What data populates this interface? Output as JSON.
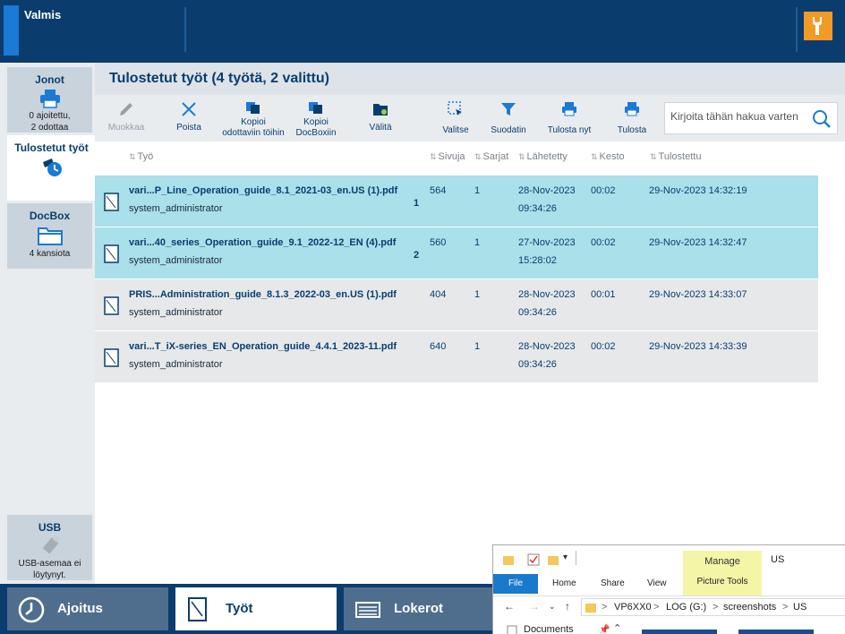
{
  "status": {
    "text": "Valmis"
  },
  "leftnav": {
    "queues": {
      "title": "Jonot",
      "line1": "0 ajoitettu,",
      "line2": "2 odottaa"
    },
    "printed": {
      "title": "Tulostetut työt"
    },
    "docbox": {
      "title": "DocBox",
      "sub": "4 kansiota"
    },
    "usb": {
      "title": "USB",
      "line1": "USB-asemaa ei",
      "line2": "löytynyt."
    }
  },
  "main": {
    "title": "Tulostetut työt (4 työtä, 2 valittu)",
    "toolbar": {
      "edit": "Muokkaa",
      "delete": "Poista",
      "copy_waiting_1": "Kopioi",
      "copy_waiting_2": "odottaviin töihin",
      "copy_docbox_1": "Kopioi",
      "copy_docbox_2": "DocBoxiin",
      "forward": "Välitä",
      "select": "Valitse",
      "filter": "Suodatin",
      "print_now": "Tulosta nyt",
      "print": "Tulosta"
    },
    "search": {
      "placeholder": "Kirjoita tähän hakua varten"
    },
    "columns": {
      "job": "Työ",
      "pages": "Sivuja",
      "sets": "Sarjat",
      "sent": "Lähetetty",
      "duration": "Kesto",
      "printed": "Tulostettu"
    },
    "rows": [
      {
        "name": "vari...P_Line_Operation_guide_8.1_2021-03_en.US (1).pdf",
        "owner": "system_administrator",
        "selnum": "1",
        "pages": "564",
        "sets": "1",
        "sent_date": "28-Nov-2023",
        "sent_time": "09:34:26",
        "duration": "00:02",
        "printed": "29-Nov-2023 14:32:19"
      },
      {
        "name": "vari...40_series_Operation_guide_9.1_2022-12_EN (4).pdf",
        "owner": "system_administrator",
        "selnum": "2",
        "pages": "560",
        "sets": "1",
        "sent_date": "27-Nov-2023",
        "sent_time": "15:28:02",
        "duration": "00:02",
        "printed": "29-Nov-2023 14:32:47"
      },
      {
        "name": "PRIS...Administration_guide_8.1.3_2022-03_en.US (1).pdf",
        "owner": "system_administrator",
        "selnum": "",
        "pages": "404",
        "sets": "1",
        "sent_date": "28-Nov-2023",
        "sent_time": "09:34:26",
        "duration": "00:01",
        "printed": "29-Nov-2023 14:33:07"
      },
      {
        "name": "vari...T_iX-series_EN_Operation_guide_4.4.1_2023-11.pdf",
        "owner": "system_administrator",
        "selnum": "",
        "pages": "640",
        "sets": "1",
        "sent_date": "28-Nov-2023",
        "sent_time": "09:34:26",
        "duration": "00:02",
        "printed": "29-Nov-2023 14:33:39"
      }
    ]
  },
  "bottomtabs": {
    "schedule": "Ajoitus",
    "jobs": "Työt",
    "trays": "Lokerot"
  },
  "explorer": {
    "manage": "Manage",
    "picture_tools": "Picture Tools",
    "folder_name": "US",
    "tabs": {
      "file": "File",
      "home": "Home",
      "share": "Share",
      "view": "View"
    },
    "path": [
      "VP6XX0",
      "LOG (G:)",
      "screenshots",
      "US"
    ],
    "quick": "Documents"
  }
}
